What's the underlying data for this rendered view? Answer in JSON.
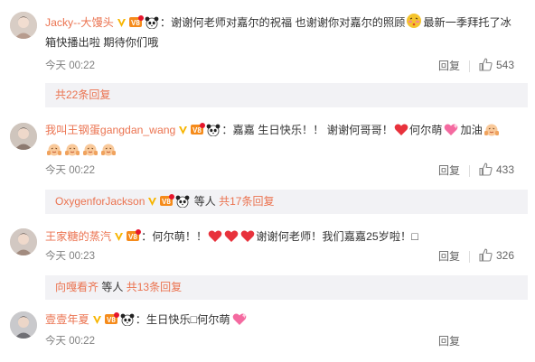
{
  "comments": [
    {
      "username": "Jacky--大馒头",
      "text_1": "：谢谢何老师对嘉尔的祝福 也谢谢你对嘉尔的照顾",
      "text_2": "最新一季拜托了冰",
      "text_line2": "箱快播出啦 期待你们哦",
      "time": "今天 00:22",
      "reply_label": "回复",
      "likes": "543"
    },
    {
      "username": "我叫王钢蛋gangdan_wang",
      "text_1": "：嘉嘉 生日快乐！！ 谢谢何哥哥！",
      "text_2": "何尔萌",
      "text_3": "加油",
      "time": "今天 00:22",
      "reply_label": "回复",
      "likes": "433"
    },
    {
      "username": "王家糖的蒸汽",
      "text_1": "：何尔萌！！",
      "text_2": "谢谢何老师！我们嘉嘉25岁啦！□",
      "time": "今天 00:23",
      "reply_label": "回复",
      "likes": "326"
    },
    {
      "username": "壹壹年夏",
      "text_1": "：生日快乐□何尔萌",
      "time": "今天 00:22",
      "reply_label": "回复"
    }
  ],
  "subs": [
    {
      "link": "共22条回复"
    },
    {
      "user": "OxygenforJackson",
      "etc": "等人",
      "count": "共17条回复"
    },
    {
      "user": "向嘎看齐",
      "etc": "等人",
      "count": "共13条回复"
    }
  ],
  "colors": {
    "username": "#eb7350",
    "text": "#333333",
    "meta": "#808080",
    "subbox": "#f2f2f5"
  }
}
